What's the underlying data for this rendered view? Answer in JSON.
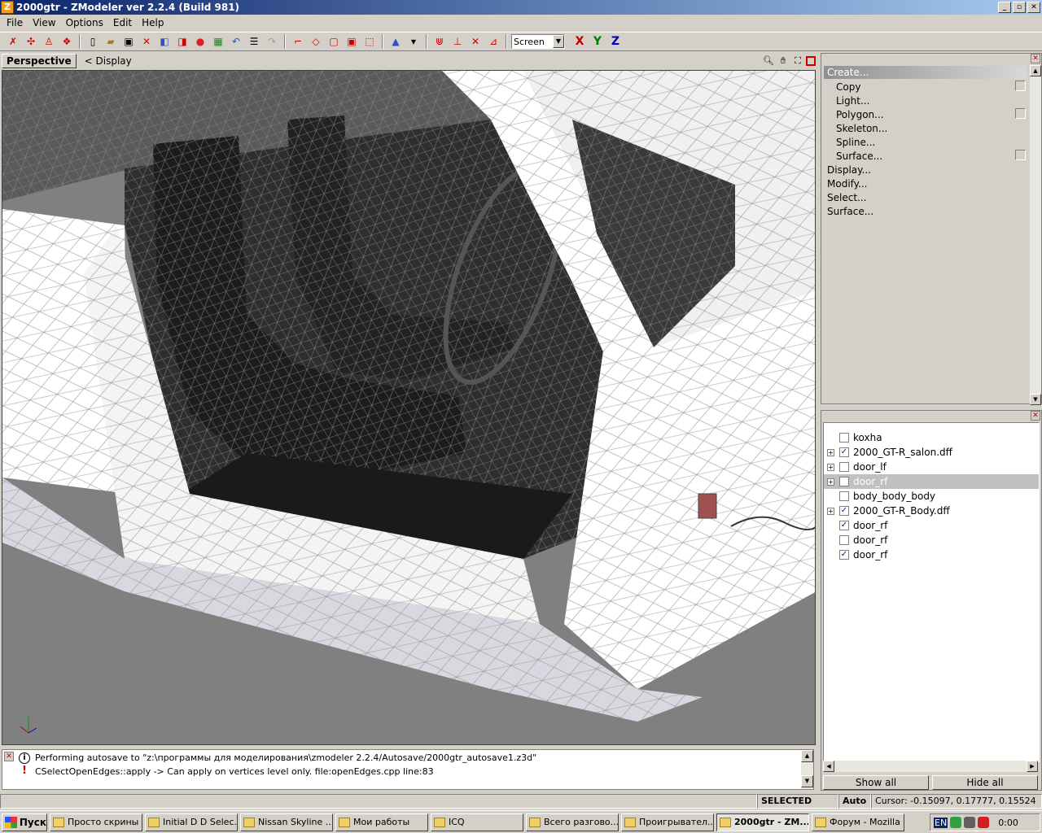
{
  "window": {
    "title": "2000gtr - ZModeler ver 2.2.4 (Build 981)",
    "app_icon_letter": "Z"
  },
  "menu": [
    {
      "label": "File",
      "key": "F"
    },
    {
      "label": "View",
      "key": "V"
    },
    {
      "label": "Options",
      "key": "O"
    },
    {
      "label": "Edit",
      "key": "E"
    },
    {
      "label": "Help",
      "key": "H"
    }
  ],
  "toolbar": {
    "view_select": "Screen",
    "axis_x": "X",
    "axis_y": "Y",
    "axis_z": "Z"
  },
  "viewport": {
    "tab": "Perspective",
    "display": "<  Display"
  },
  "create_panel": {
    "header": "Create...",
    "items": [
      {
        "label": "Copy",
        "sub": true
      },
      {
        "label": "Light...",
        "sub": true
      },
      {
        "label": "Polygon...",
        "sub": true
      },
      {
        "label": "Skeleton...",
        "sub": true
      },
      {
        "label": "Spline...",
        "sub": true
      },
      {
        "label": "Surface...",
        "sub": true
      },
      {
        "label": "Display...",
        "sub": false
      },
      {
        "label": "Modify...",
        "sub": false
      },
      {
        "label": "Select...",
        "sub": false
      },
      {
        "label": "Surface...",
        "sub": false
      }
    ]
  },
  "tree": {
    "rows": [
      {
        "label": "koxha",
        "checked": false,
        "expander": false,
        "selected": false
      },
      {
        "label": "2000_GT-R_salon.dff",
        "checked": true,
        "expander": true,
        "selected": false
      },
      {
        "label": "door_lf",
        "checked": false,
        "expander": true,
        "selected": false
      },
      {
        "label": "door_rf",
        "checked": false,
        "expander": true,
        "selected": true
      },
      {
        "label": "body_body_body",
        "checked": false,
        "expander": false,
        "selected": false
      },
      {
        "label": "2000_GT-R_Body.dff",
        "checked": true,
        "expander": true,
        "selected": false
      },
      {
        "label": "door_rf",
        "checked": true,
        "expander": false,
        "selected": false
      },
      {
        "label": "door_rf",
        "checked": false,
        "expander": false,
        "selected": false
      },
      {
        "label": "door_rf",
        "checked": true,
        "expander": false,
        "selected": false
      }
    ],
    "show_all": "Show all",
    "hide_all": "Hide all"
  },
  "log": [
    {
      "type": "info",
      "text": "Performing autosave to \"z:\\программы для моделирования\\zmodeler 2.2.4/Autosave/2000gtr_autosave1.z3d\""
    },
    {
      "type": "warn",
      "text": "CSelectOpenEdges::apply -> Can apply on vertices level only. file:openEdges.cpp line:83"
    }
  ],
  "status": {
    "mode": "SELECTED MODE",
    "auto": "Auto",
    "cursor": "Cursor: -0.15097, 0.17777, 0.15524"
  },
  "taskbar": {
    "start": "Пуск",
    "tasks": [
      {
        "label": "Просто скрины",
        "active": false
      },
      {
        "label": "Initial D D Selec...",
        "active": false
      },
      {
        "label": "Nissan Skyline ...",
        "active": false
      },
      {
        "label": "Мои работы",
        "active": false
      },
      {
        "label": "ICQ",
        "active": false
      },
      {
        "label": "Всего разгово...",
        "active": false
      },
      {
        "label": "Проигрывател...",
        "active": false
      },
      {
        "label": "2000gtr - ZM...",
        "active": true
      },
      {
        "label": "Форум - Mozilla ...",
        "active": false
      }
    ],
    "lang": "EN",
    "clock": "0:00"
  },
  "colors": {
    "titlebar_start": "#0a246a",
    "viewport_bg": "#808080",
    "car_body": "#ffffff",
    "interior": "#2a2a2a"
  }
}
